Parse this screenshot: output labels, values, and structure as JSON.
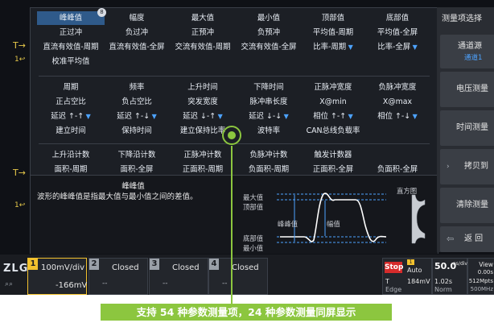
{
  "left_markers": {
    "trigger": "T→",
    "ch1": "1↩"
  },
  "rows": [
    {
      "items": [
        {
          "label": "峰峰值",
          "selected": true,
          "badge": "8"
        },
        {
          "label": "幅度"
        },
        {
          "label": "最大值"
        },
        {
          "label": "最小值"
        },
        {
          "label": "顶部值"
        },
        {
          "label": "底部值"
        }
      ]
    },
    {
      "items": [
        {
          "label": "正过冲"
        },
        {
          "label": "负过冲"
        },
        {
          "label": "正预冲"
        },
        {
          "label": "负预冲"
        },
        {
          "label": "平均值-周期"
        },
        {
          "label": "平均值-全屏"
        }
      ]
    },
    {
      "items": [
        {
          "label": "直流有效值-周期"
        },
        {
          "label": "直流有效值-全屏"
        },
        {
          "label": "交流有效值-周期"
        },
        {
          "label": "交流有效值-全屏"
        },
        {
          "label": "比率-周期",
          "dropdown": true
        },
        {
          "label": "比率-全屏",
          "dropdown": true
        }
      ]
    },
    {
      "items": [
        {
          "label": "校准平均值"
        }
      ]
    },
    {
      "items": [
        {
          "label": "周期"
        },
        {
          "label": "频率"
        },
        {
          "label": "上升时间"
        },
        {
          "label": "下降时间"
        },
        {
          "label": "正脉冲宽度"
        },
        {
          "label": "负脉冲宽度"
        }
      ]
    },
    {
      "items": [
        {
          "label": "正占空比"
        },
        {
          "label": "负占空比"
        },
        {
          "label": "突发宽度"
        },
        {
          "label": "脉冲串长度"
        },
        {
          "label": "X@min"
        },
        {
          "label": "X@max"
        }
      ]
    },
    {
      "items": [
        {
          "label": "延迟 ↑-↑",
          "dropdown": true
        },
        {
          "label": "延迟 ↑-↓",
          "dropdown": true
        },
        {
          "label": "延迟 ↓-↑",
          "dropdown": true
        },
        {
          "label": "延迟 ↓-↓",
          "dropdown": true
        },
        {
          "label": "相位 ↑-↑",
          "dropdown": true
        },
        {
          "label": "相位 ↑-↓",
          "dropdown": true
        }
      ]
    },
    {
      "items": [
        {
          "label": "建立时间"
        },
        {
          "label": "保持时间"
        },
        {
          "label": "建立保持比率"
        },
        {
          "label": "波特率"
        },
        {
          "label": "CAN总线负载率"
        }
      ]
    },
    {
      "items": [
        {
          "label": "上升沿计数"
        },
        {
          "label": "下降沿计数"
        },
        {
          "label": "正脉冲计数"
        },
        {
          "label": "负脉冲计数"
        },
        {
          "label": "触发计数器"
        }
      ]
    },
    {
      "items": [
        {
          "label": "面积-周期"
        },
        {
          "label": "面积-全屏"
        },
        {
          "label": "正面积-周期"
        },
        {
          "label": "负面积-周期"
        },
        {
          "label": "正面积-全屏"
        },
        {
          "label": "负面积-全屏"
        }
      ]
    }
  ],
  "description": {
    "title": "峰峰值",
    "text": "波形的峰峰值是指最大值与最小值之间的差值。",
    "wave_labels": {
      "max": "最大值",
      "top": "顶部值",
      "base": "底部值",
      "min": "最小值",
      "pkpk": "峰峰值",
      "amp": "幅值",
      "hist": "直方图"
    }
  },
  "sidebar": {
    "title": "测量项选择",
    "buttons": [
      {
        "label": "通道源",
        "sub": "通道1"
      },
      {
        "label": "电压测量"
      },
      {
        "label": "时间测量"
      },
      {
        "label": "拷贝到"
      },
      {
        "label": "清除测量"
      },
      {
        "label": "返 回"
      }
    ]
  },
  "bottom": {
    "logo": "ZLG",
    "ch1": {
      "num": "1",
      "scale": "100mV/div",
      "offset": "-166mV",
      "color": "#f2c12e"
    },
    "ch2": {
      "num": "2",
      "status": "Closed",
      "dash": "--"
    },
    "ch3": {
      "num": "3",
      "status": "Closed",
      "dash": "--"
    },
    "ch4": {
      "num": "4",
      "status": "Closed",
      "dash": "--"
    },
    "run": {
      "state": "Stop",
      "mode": "Auto",
      "t_label": "T",
      "t_val": "184mV",
      "edge": "Edge",
      "ch": "1"
    },
    "timebase": {
      "scale": "50.0",
      "unit": "ns/div",
      "delay": "1.02s",
      "mode": "Norm"
    },
    "view": {
      "label": "View",
      "v1": "0.00s",
      "rate": "512Mpts",
      "sr": "500MHz"
    }
  },
  "caption": "支持 54 种参数测量项，24 种参数测量同屏显示"
}
